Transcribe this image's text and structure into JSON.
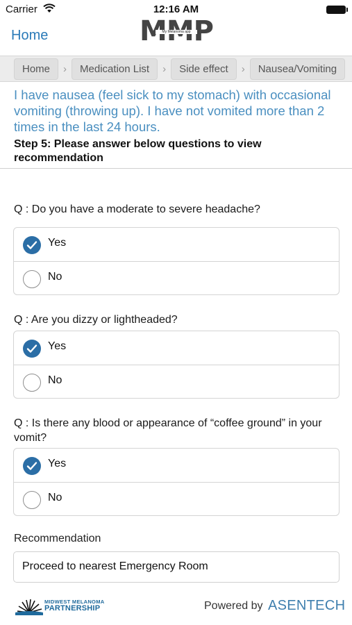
{
  "status_bar": {
    "carrier": "Carrier",
    "time": "12:16 AM"
  },
  "nav": {
    "home_label": "Home",
    "logo_text": "MMP",
    "logo_subtitle": "My Melanoma app"
  },
  "breadcrumb": [
    "Home",
    "Medication List",
    "Side effect",
    "Nausea/Vomiting"
  ],
  "condition_text": "I have nausea (feel sick to my stomach) with occasional vomiting (throwing up). I have not vomited more than 2 times in the last 24 hours.",
  "step_text": "Step 5: Please answer below questions to view recommendation",
  "questions": [
    {
      "text": "Q : Do you have a moderate to severe headache?",
      "options": [
        "Yes",
        "No"
      ],
      "selected": "Yes"
    },
    {
      "text": "Q : Are you dizzy or lightheaded?",
      "options": [
        "Yes",
        "No"
      ],
      "selected": "Yes"
    },
    {
      "text": "Q : Is there any blood or appearance of “coffee ground” in your vomit?",
      "options": [
        "Yes",
        "No"
      ],
      "selected": "Yes"
    }
  ],
  "recommendation": {
    "label": "Recommendation",
    "value": "Proceed to nearest Emergency Room"
  },
  "footer": {
    "partner_line1": "MIDWEST MELANOMA",
    "partner_line2": "PARTNERSHIP",
    "powered_by": "Powered by",
    "company": "ASENTECH"
  },
  "colors": {
    "accent": "#2a7ab8",
    "condition_text": "#4a8fc0",
    "radio_checked": "#2b6ea6"
  },
  "icons": {
    "wifi": "wifi-icon",
    "battery": "battery-icon",
    "check": "check-icon",
    "chevron": "chevron-right-icon"
  }
}
